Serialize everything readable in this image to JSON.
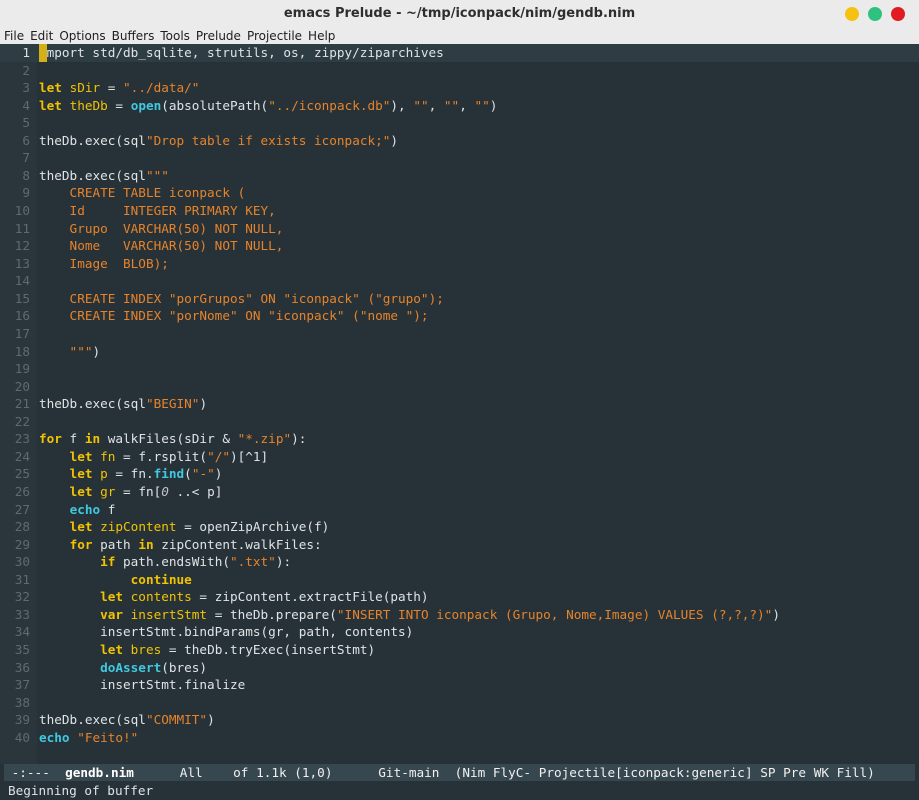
{
  "window": {
    "title": "emacs Prelude - ~/tmp/iconpack/nim/gendb.nim",
    "button_colors": [
      "#f5c211",
      "#2ec27e",
      "#e01b24"
    ]
  },
  "menu": {
    "items": [
      "File",
      "Edit",
      "Options",
      "Buffers",
      "Tools",
      "Prelude",
      "Projectile",
      "Help"
    ]
  },
  "editor": {
    "colors": {
      "keyword": "#f2c300",
      "builtin": "#40c8e0",
      "string": "#e6832b",
      "background": "#263238"
    },
    "lines": [
      {
        "n": "1",
        "segs": [
          {
            "t": "mport std/db_sqlite, strutils, os, zippy/ziparchives",
            "c": ""
          }
        ]
      },
      {
        "n": "2",
        "segs": []
      },
      {
        "n": "3",
        "segs": [
          {
            "t": "let",
            "c": "kw"
          },
          {
            "t": " ",
            "c": ""
          },
          {
            "t": "sDir",
            "c": "vn"
          },
          {
            "t": " = ",
            "c": ""
          },
          {
            "t": "\"../data/\"",
            "c": "str"
          }
        ]
      },
      {
        "n": "4",
        "segs": [
          {
            "t": "let",
            "c": "kw"
          },
          {
            "t": " ",
            "c": ""
          },
          {
            "t": "theDb",
            "c": "vn"
          },
          {
            "t": " = ",
            "c": ""
          },
          {
            "t": "open",
            "c": "kw2"
          },
          {
            "t": "(absolutePath(",
            "c": ""
          },
          {
            "t": "\"../iconpack.db\"",
            "c": "str"
          },
          {
            "t": "), ",
            "c": ""
          },
          {
            "t": "\"\"",
            "c": "str"
          },
          {
            "t": ", ",
            "c": ""
          },
          {
            "t": "\"\"",
            "c": "str"
          },
          {
            "t": ", ",
            "c": ""
          },
          {
            "t": "\"\"",
            "c": "str"
          },
          {
            "t": ")",
            "c": ""
          }
        ]
      },
      {
        "n": "5",
        "segs": []
      },
      {
        "n": "6",
        "segs": [
          {
            "t": "theDb.exec(sql",
            "c": ""
          },
          {
            "t": "\"Drop table if exists iconpack;\"",
            "c": "str"
          },
          {
            "t": ")",
            "c": ""
          }
        ]
      },
      {
        "n": "7",
        "segs": []
      },
      {
        "n": "8",
        "segs": [
          {
            "t": "theDb.exec(sql",
            "c": ""
          },
          {
            "t": "\"\"\"",
            "c": "str"
          }
        ]
      },
      {
        "n": "9",
        "segs": [
          {
            "t": "    CREATE TABLE iconpack (",
            "c": "str"
          }
        ]
      },
      {
        "n": "10",
        "segs": [
          {
            "t": "    Id     INTEGER PRIMARY KEY,",
            "c": "str"
          }
        ]
      },
      {
        "n": "11",
        "segs": [
          {
            "t": "    Grupo  VARCHAR(50) NOT NULL,",
            "c": "str"
          }
        ]
      },
      {
        "n": "12",
        "segs": [
          {
            "t": "    Nome   VARCHAR(50) NOT NULL,",
            "c": "str"
          }
        ]
      },
      {
        "n": "13",
        "segs": [
          {
            "t": "    Image  BLOB);",
            "c": "str"
          }
        ]
      },
      {
        "n": "14",
        "segs": []
      },
      {
        "n": "15",
        "segs": [
          {
            "t": "    CREATE INDEX \"porGrupos\" ON \"iconpack\" (\"grupo\");",
            "c": "str"
          }
        ]
      },
      {
        "n": "16",
        "segs": [
          {
            "t": "    CREATE INDEX \"porNome\" ON \"iconpack\" (\"nome \");",
            "c": "str"
          }
        ]
      },
      {
        "n": "17",
        "segs": []
      },
      {
        "n": "18",
        "segs": [
          {
            "t": "    \"\"\"",
            "c": "str"
          },
          {
            "t": ")",
            "c": ""
          }
        ]
      },
      {
        "n": "19",
        "segs": []
      },
      {
        "n": "20",
        "segs": []
      },
      {
        "n": "21",
        "segs": [
          {
            "t": "theDb.exec(sql",
            "c": ""
          },
          {
            "t": "\"BEGIN\"",
            "c": "str"
          },
          {
            "t": ")",
            "c": ""
          }
        ]
      },
      {
        "n": "22",
        "segs": []
      },
      {
        "n": "23",
        "segs": [
          {
            "t": "for",
            "c": "kw"
          },
          {
            "t": " f ",
            "c": ""
          },
          {
            "t": "in",
            "c": "kw"
          },
          {
            "t": " walkFiles(sDir & ",
            "c": ""
          },
          {
            "t": "\"*.zip\"",
            "c": "str"
          },
          {
            "t": "):",
            "c": ""
          }
        ]
      },
      {
        "n": "24",
        "segs": [
          {
            "t": "    ",
            "c": ""
          },
          {
            "t": "let",
            "c": "kw"
          },
          {
            "t": " ",
            "c": ""
          },
          {
            "t": "fn",
            "c": "vn"
          },
          {
            "t": " = f.rsplit(",
            "c": ""
          },
          {
            "t": "\"/\"",
            "c": "str"
          },
          {
            "t": ")[^1]",
            "c": ""
          }
        ]
      },
      {
        "n": "25",
        "segs": [
          {
            "t": "    ",
            "c": ""
          },
          {
            "t": "let",
            "c": "kw"
          },
          {
            "t": " ",
            "c": ""
          },
          {
            "t": "p",
            "c": "vn"
          },
          {
            "t": " = fn.",
            "c": ""
          },
          {
            "t": "find",
            "c": "kw2"
          },
          {
            "t": "(",
            "c": ""
          },
          {
            "t": "\"-\"",
            "c": "str"
          },
          {
            "t": ")",
            "c": ""
          }
        ]
      },
      {
        "n": "26",
        "segs": [
          {
            "t": "    ",
            "c": ""
          },
          {
            "t": "let",
            "c": "kw"
          },
          {
            "t": " ",
            "c": ""
          },
          {
            "t": "gr",
            "c": "vn"
          },
          {
            "t": " = fn[",
            "c": ""
          },
          {
            "t": "0",
            "c": "it"
          },
          {
            "t": " ..< p]",
            "c": ""
          }
        ]
      },
      {
        "n": "27",
        "segs": [
          {
            "t": "    ",
            "c": ""
          },
          {
            "t": "echo",
            "c": "kw2"
          },
          {
            "t": " f",
            "c": ""
          }
        ]
      },
      {
        "n": "28",
        "segs": [
          {
            "t": "    ",
            "c": ""
          },
          {
            "t": "let",
            "c": "kw"
          },
          {
            "t": " ",
            "c": ""
          },
          {
            "t": "zipContent",
            "c": "vn"
          },
          {
            "t": " = openZipArchive(f)",
            "c": ""
          }
        ]
      },
      {
        "n": "29",
        "segs": [
          {
            "t": "    ",
            "c": ""
          },
          {
            "t": "for",
            "c": "kw"
          },
          {
            "t": " path ",
            "c": ""
          },
          {
            "t": "in",
            "c": "kw"
          },
          {
            "t": " zipContent.walkFiles:",
            "c": ""
          }
        ]
      },
      {
        "n": "30",
        "segs": [
          {
            "t": "        ",
            "c": ""
          },
          {
            "t": "if",
            "c": "kw"
          },
          {
            "t": " path.endsWith(",
            "c": ""
          },
          {
            "t": "\".txt\"",
            "c": "str"
          },
          {
            "t": "):",
            "c": ""
          }
        ]
      },
      {
        "n": "31",
        "segs": [
          {
            "t": "            ",
            "c": ""
          },
          {
            "t": "continue",
            "c": "kw"
          }
        ]
      },
      {
        "n": "32",
        "segs": [
          {
            "t": "        ",
            "c": ""
          },
          {
            "t": "let",
            "c": "kw"
          },
          {
            "t": " ",
            "c": ""
          },
          {
            "t": "contents",
            "c": "vn"
          },
          {
            "t": " = zipContent.extractFile(path)",
            "c": ""
          }
        ]
      },
      {
        "n": "33",
        "segs": [
          {
            "t": "        ",
            "c": ""
          },
          {
            "t": "var",
            "c": "kw"
          },
          {
            "t": " ",
            "c": ""
          },
          {
            "t": "insertStmt",
            "c": "vn"
          },
          {
            "t": " = theDb.prepare(",
            "c": ""
          },
          {
            "t": "\"INSERT INTO iconpack (Grupo, Nome,Image) VALUES (?,?,?)\"",
            "c": "str"
          },
          {
            "t": ")",
            "c": ""
          }
        ]
      },
      {
        "n": "34",
        "segs": [
          {
            "t": "        insertStmt.bindParams(gr, path, contents)",
            "c": ""
          }
        ]
      },
      {
        "n": "35",
        "segs": [
          {
            "t": "        ",
            "c": ""
          },
          {
            "t": "let",
            "c": "kw"
          },
          {
            "t": " ",
            "c": ""
          },
          {
            "t": "bres",
            "c": "vn"
          },
          {
            "t": " = theDb.tryExec(insertStmt)",
            "c": ""
          }
        ]
      },
      {
        "n": "36",
        "segs": [
          {
            "t": "        ",
            "c": ""
          },
          {
            "t": "doAssert",
            "c": "kw2"
          },
          {
            "t": "(bres)",
            "c": ""
          }
        ]
      },
      {
        "n": "37",
        "segs": [
          {
            "t": "        insertStmt.finalize",
            "c": ""
          }
        ]
      },
      {
        "n": "38",
        "segs": []
      },
      {
        "n": "39",
        "segs": [
          {
            "t": "theDb.exec(sql",
            "c": ""
          },
          {
            "t": "\"COMMIT\"",
            "c": "str"
          },
          {
            "t": ")",
            "c": ""
          }
        ]
      },
      {
        "n": "40",
        "segs": [
          {
            "t": "echo",
            "c": "kw2"
          },
          {
            "t": " ",
            "c": ""
          },
          {
            "t": "\"Feito!\"",
            "c": "str"
          }
        ]
      }
    ]
  },
  "modeline": {
    "status": " -:---  ",
    "buffer": "gendb.nim",
    "rest": "      All    of 1.1k (1,0)      Git-main  (Nim FlyC- Projectile[iconpack:generic] SP Pre WK Fill)"
  },
  "minibuffer": {
    "message": "Beginning of buffer"
  }
}
